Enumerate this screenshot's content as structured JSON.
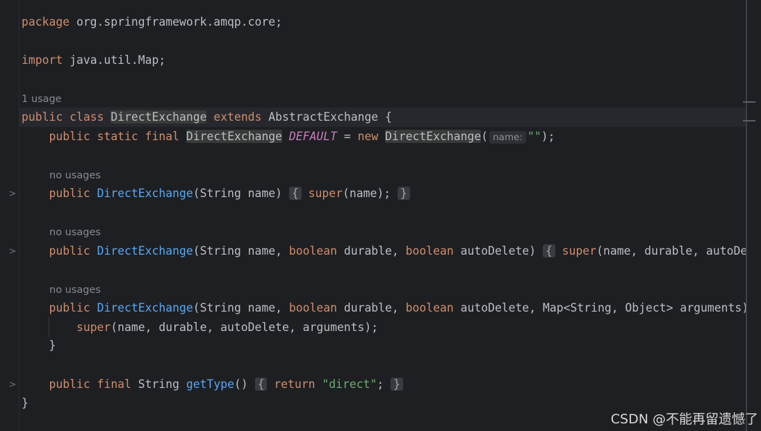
{
  "editor": {
    "line01": {
      "kw": "package",
      "rest": " org.springframework.amqp.core;"
    },
    "line02": {
      "kw": "import",
      "rest": " java.util.Map;"
    },
    "hint_class": "1 usage",
    "line03": {
      "kw1": "public",
      "kw2": "class",
      "cls": "DirectExchange",
      "kw3": "extends",
      "rest": " AbstractExchange {"
    },
    "line04": {
      "kw1": "public",
      "kw2": "static",
      "kw3": "final",
      "type": "DirectExchange",
      "field": "DEFAULT",
      "eq": " = ",
      "kw4": "new",
      "ctor": "DirectExchange",
      "open": "(",
      "param_hint": "name:",
      "arg": "\"\"",
      "close": ");"
    },
    "hint_ctor1": "no usages",
    "line05": {
      "kw": "public",
      "fn": "DirectExchange",
      "params": "(String name)",
      "brace_open": "{",
      "kw_super": "super",
      "call": "(name);",
      "brace_close": "}"
    },
    "hint_ctor2": "no usages",
    "line06": {
      "kw": "public",
      "fn": "DirectExchange",
      "p1": "(String name, ",
      "kw_b1": "boolean",
      "p2": " durable, ",
      "kw_b2": "boolean",
      "p3": " autoDelete)",
      "brace_open": "{",
      "kw_super": "super",
      "call": "(name, durable, autoDel"
    },
    "hint_ctor3": "no usages",
    "line07": {
      "kw": "public",
      "fn": "DirectExchange",
      "p1": "(String name, ",
      "kw_b1": "boolean",
      "p2": " durable, ",
      "kw_b2": "boolean",
      "p3": " autoDelete, Map<String, Object> arguments)"
    },
    "line08": {
      "kw_super": "super",
      "call": "(name, durable, autoDelete, arguments);"
    },
    "line09": "}",
    "line10": {
      "kw1": "public",
      "kw2": "final",
      "type": " String ",
      "fn": "getType",
      "parens": "() ",
      "brace_open": "{",
      "kw_ret": "return",
      "str": "\"direct\"",
      "semi": ";",
      "brace_close": "}"
    },
    "line11": "}"
  },
  "gutter": {
    "fold_icon": "chevron-right-icon",
    "fold_glyph": ">"
  },
  "watermark": "CSDN @不能再留遗憾了",
  "colors": {
    "background": "#1e1f22",
    "keyword": "#cf8e6d",
    "function": "#56a8f5",
    "string": "#6aab73",
    "static_field": "#c77dbb",
    "text": "#bcbec4",
    "hint": "#868a91"
  }
}
